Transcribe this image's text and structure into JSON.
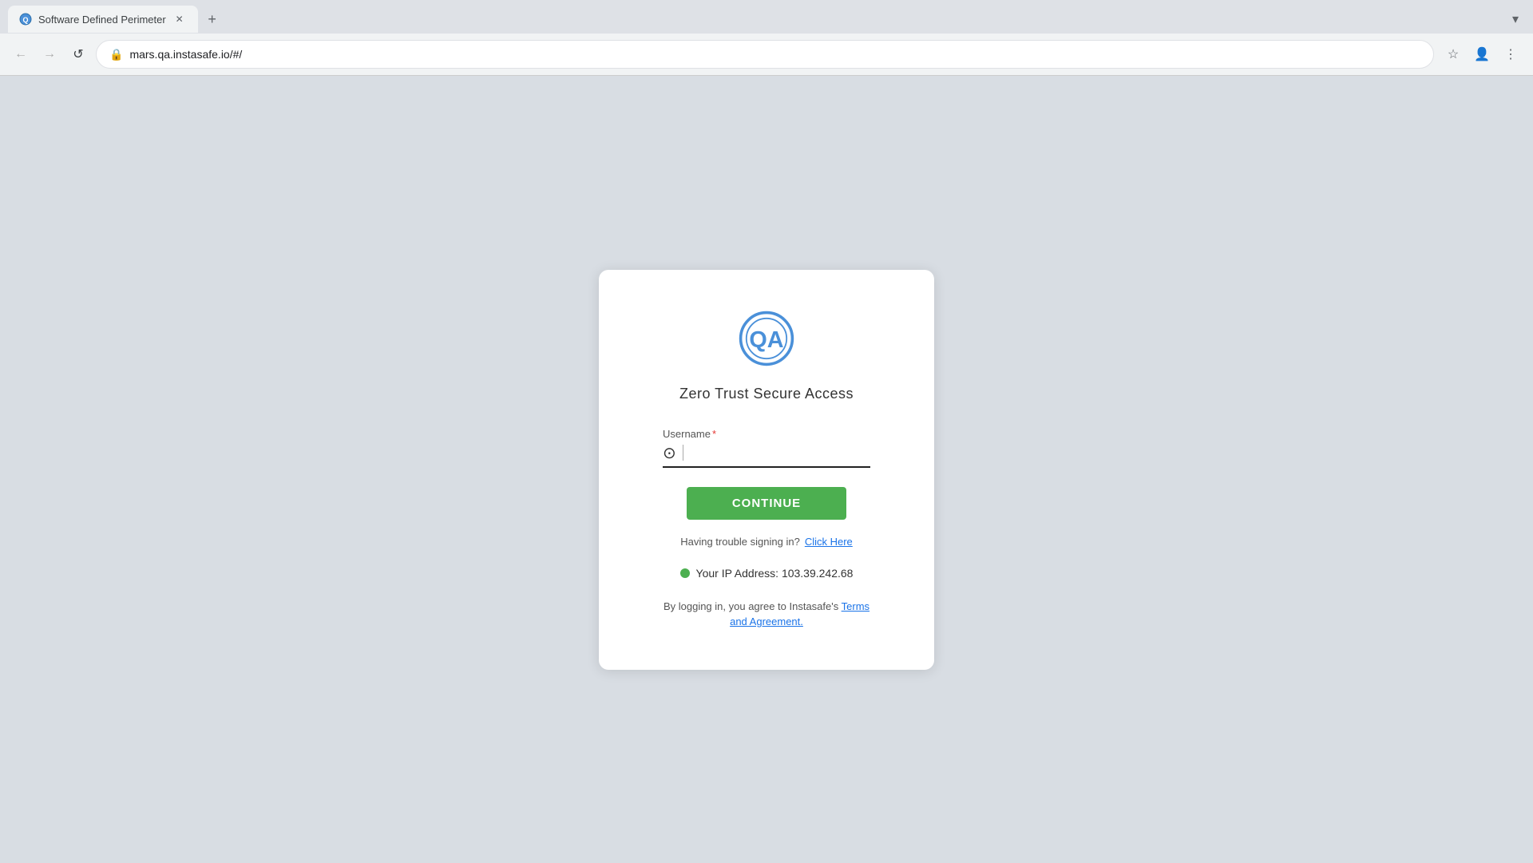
{
  "browser": {
    "tab": {
      "title": "Software Defined Perimeter",
      "favicon": "🔵"
    },
    "new_tab_label": "+",
    "dropdown_label": "▾",
    "nav": {
      "back_icon": "←",
      "forward_icon": "→",
      "reload_icon": "↺"
    },
    "url": "mars.qa.instasafe.io/#/",
    "address_actions": {
      "bookmark_icon": "☆",
      "profile_icon": "👤",
      "menu_icon": "⋮"
    }
  },
  "login": {
    "logo_alt": "QA Logo",
    "title": "Zero Trust  Secure Access",
    "form": {
      "username_label": "Username",
      "username_required": "*",
      "username_placeholder": ""
    },
    "continue_button": "CONTINUE",
    "trouble_text": "Having trouble signing in?",
    "trouble_link": "Click Here",
    "ip_label": "Your IP Address: 103.39.242.68",
    "terms_prefix": "By logging in, you agree to Instasafe's",
    "terms_link": "Terms and Agreement."
  }
}
